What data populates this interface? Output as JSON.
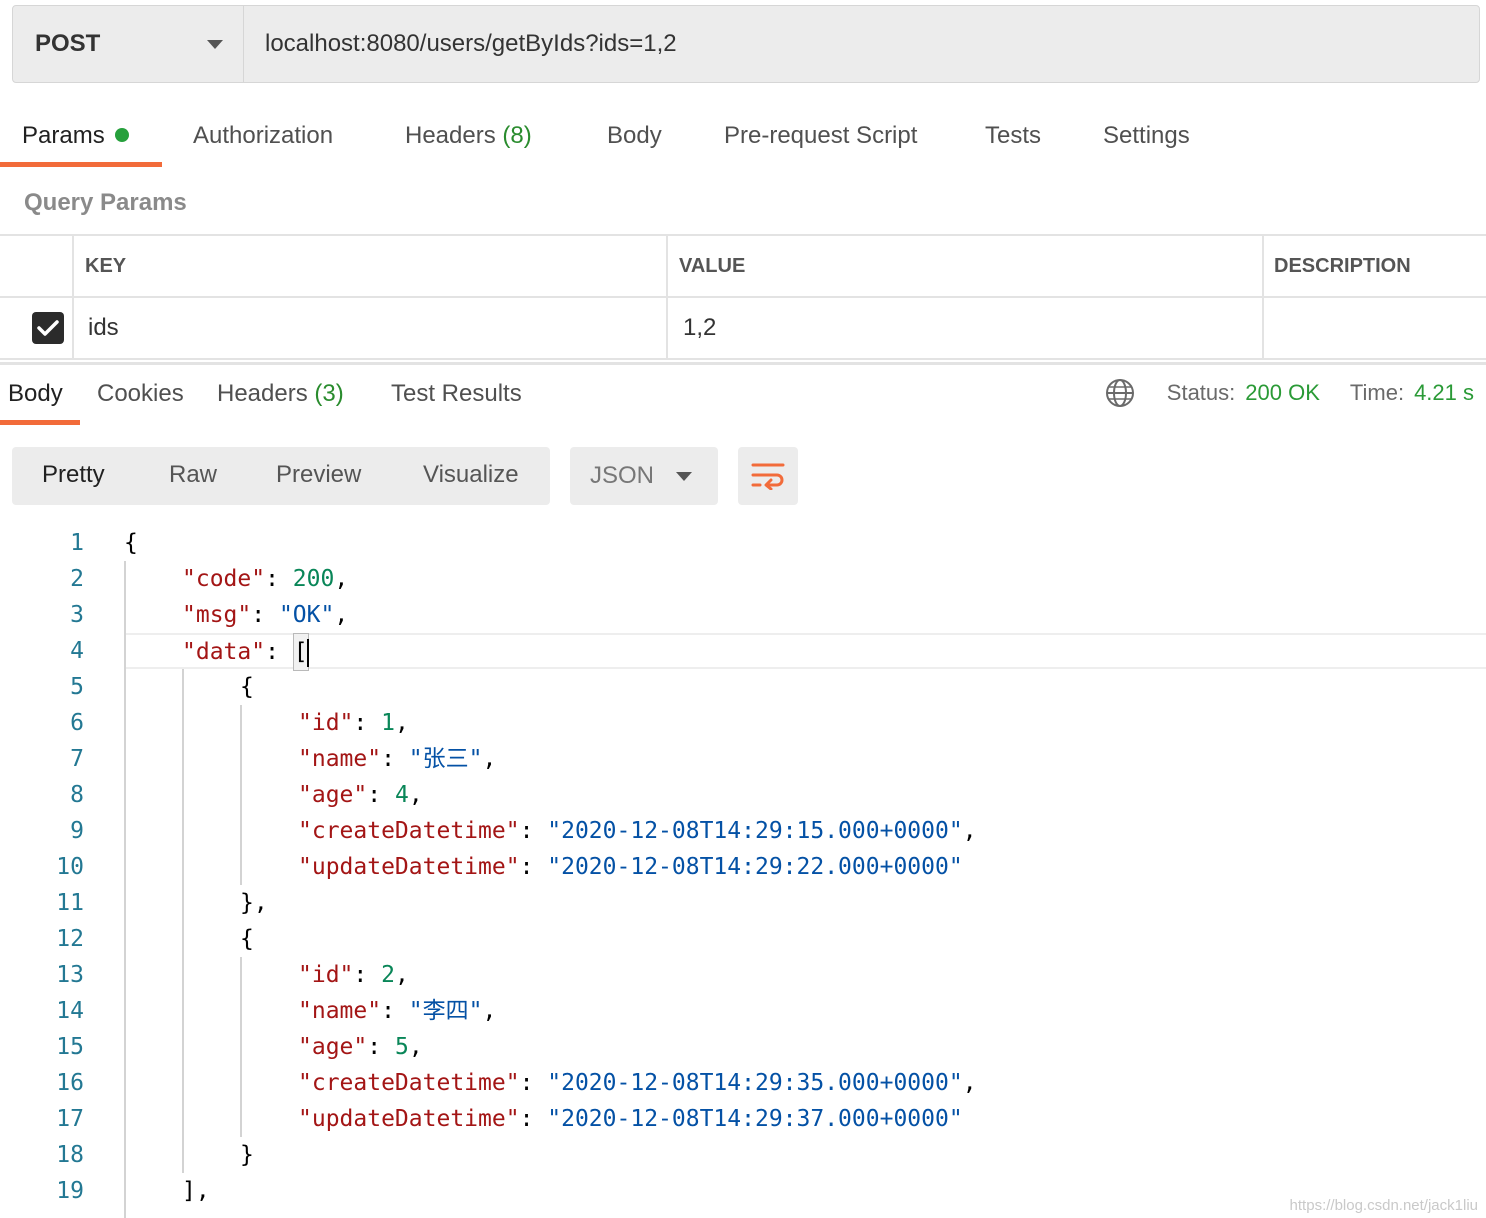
{
  "request": {
    "method": "POST",
    "url": "localhost:8080/users/getByIds?ids=1,2"
  },
  "request_tabs": [
    {
      "label": "Params",
      "count": ""
    },
    {
      "label": "Authorization",
      "count": ""
    },
    {
      "label": "Headers",
      "count": "(8)"
    },
    {
      "label": "Body",
      "count": ""
    },
    {
      "label": "Pre-request Script",
      "count": ""
    },
    {
      "label": "Tests",
      "count": ""
    },
    {
      "label": "Settings",
      "count": ""
    }
  ],
  "query_params": {
    "title": "Query Params",
    "headers": [
      "KEY",
      "VALUE",
      "DESCRIPTION"
    ],
    "rows": [
      {
        "checked": true,
        "key": "ids",
        "value": "1,2",
        "description": ""
      }
    ]
  },
  "response_tabs": [
    {
      "label": "Body",
      "count": ""
    },
    {
      "label": "Cookies",
      "count": ""
    },
    {
      "label": "Headers",
      "count": "(3)"
    },
    {
      "label": "Test Results",
      "count": ""
    }
  ],
  "response_status": {
    "status_label": "Status:",
    "status_value": "200 OK",
    "time_label": "Time:",
    "time_value": "4.21 s"
  },
  "view_modes": [
    "Pretty",
    "Raw",
    "Preview",
    "Visualize"
  ],
  "format": "JSON",
  "code_lines": [
    {
      "num": "1",
      "text": "{"
    },
    {
      "num": "2",
      "text": "\"code\": 200,"
    },
    {
      "num": "3",
      "text": "\"msg\": \"OK\","
    },
    {
      "num": "4",
      "text": "\"data\": ["
    },
    {
      "num": "5",
      "text": "{"
    },
    {
      "num": "6",
      "text": "\"id\": 1,"
    },
    {
      "num": "7",
      "text": "\"name\": \"张三\","
    },
    {
      "num": "8",
      "text": "\"age\": 4,"
    },
    {
      "num": "9",
      "text": "\"createDatetime\": \"2020-12-08T14:29:15.000+0000\","
    },
    {
      "num": "10",
      "text": "\"updateDatetime\": \"2020-12-08T14:29:22.000+0000\""
    },
    {
      "num": "11",
      "text": "},"
    },
    {
      "num": "12",
      "text": "{"
    },
    {
      "num": "13",
      "text": "\"id\": 2,"
    },
    {
      "num": "14",
      "text": "\"name\": \"李四\","
    },
    {
      "num": "15",
      "text": "\"age\": 5,"
    },
    {
      "num": "16",
      "text": "\"createDatetime\": \"2020-12-08T14:29:35.000+0000\","
    },
    {
      "num": "17",
      "text": "\"updateDatetime\": \"2020-12-08T14:29:37.000+0000\""
    },
    {
      "num": "18",
      "text": "}"
    },
    {
      "num": "19",
      "text": "],"
    }
  ],
  "watermark": "https://blog.csdn.net/jack1liu",
  "colors": {
    "accent": "#f26b3a",
    "success": "#2a9a36",
    "json_key": "#a31515",
    "json_string": "#0451a5",
    "json_number": "#098658",
    "line_number": "#237893"
  }
}
